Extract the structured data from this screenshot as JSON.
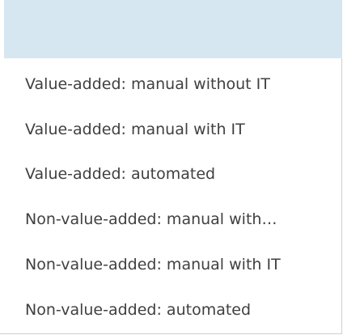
{
  "dropdown": {
    "highlighted_label": "",
    "options": [
      {
        "label": "Value-added: manual without IT"
      },
      {
        "label": "Value-added: manual with IT"
      },
      {
        "label": "Value-added: automated"
      },
      {
        "label": "Non-value-added: manual with…"
      },
      {
        "label": "Non-value-added: manual with IT"
      },
      {
        "label": "Non-value-added: automated"
      }
    ]
  },
  "colors": {
    "highlight": "#d6e7f2",
    "text": "#404040",
    "border": "#cfcfcf"
  }
}
